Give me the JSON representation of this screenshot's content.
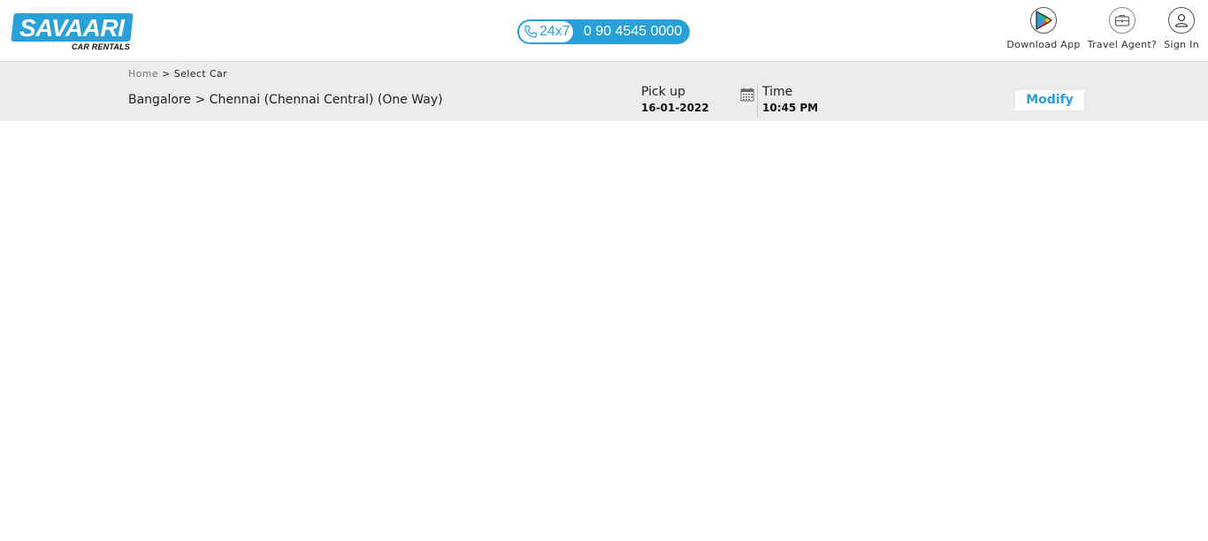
{
  "header": {
    "logo": {
      "title": "SAVAARI",
      "subtitle": "CAR RENTALS"
    },
    "helpline": {
      "label": "24x7",
      "number": "0 90 4545 0000"
    },
    "actions": [
      {
        "label": "Download App",
        "icon": "play-store-icon"
      },
      {
        "label": "Travel Agent?",
        "icon": "briefcase-icon"
      },
      {
        "label": "Sign In",
        "icon": "user-icon"
      }
    ]
  },
  "breadcrumb": {
    "home": "Home",
    "separator": ">",
    "current": "Select Car"
  },
  "trip": {
    "route": "Bangalore > Chennai (Chennai Central) (One Way)",
    "pickup_label": "Pick up",
    "pickup_date": "16-01-2022",
    "time_label": "Time",
    "time_value": "10:45 PM",
    "modify_label": "Modify"
  },
  "colors": {
    "brand": "#2aa0d8",
    "subbar_bg": "#ececea"
  }
}
